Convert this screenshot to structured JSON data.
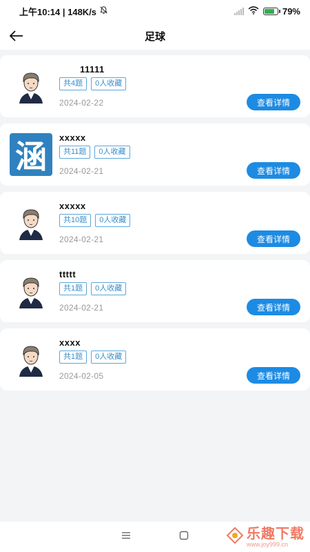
{
  "status_bar": {
    "time_speed": "上午10:14 | 148K/s",
    "battery_percent": "79%",
    "battery_level": 0.79,
    "icons": [
      "mute-bell-icon",
      "signal-icon",
      "wifi-icon",
      "battery-icon"
    ]
  },
  "header": {
    "title": "足球",
    "back_icon": "back-arrow-icon"
  },
  "cards": [
    {
      "title": "11111",
      "tag_count": "共4题",
      "tag_fav": "0人收藏",
      "date": "2024-02-22",
      "button": "查看详情",
      "avatar": "cartoon-boy-avatar"
    },
    {
      "title": "xxxxx",
      "tag_count": "共11题",
      "tag_fav": "0人收藏",
      "date": "2024-02-21",
      "button": "查看详情",
      "avatar": "涵"
    },
    {
      "title": "xxxxx",
      "tag_count": "共10题",
      "tag_fav": "0人收藏",
      "date": "2024-02-21",
      "button": "查看详情",
      "avatar": "cartoon-boy-avatar"
    },
    {
      "title": "ttttt",
      "tag_count": "共1题",
      "tag_fav": "0人收藏",
      "date": "2024-02-21",
      "button": "查看详情",
      "avatar": "cartoon-boy-avatar"
    },
    {
      "title": "xxxx",
      "tag_count": "共1题",
      "tag_fav": "0人收藏",
      "date": "2024-02-05",
      "button": "查看详情",
      "avatar": "cartoon-boy-avatar"
    }
  ],
  "nav_bar": {
    "icons": [
      "menu-icon",
      "home-icon"
    ]
  },
  "watermark": {
    "text": "乐趣下载",
    "url": "www.joy999.cn"
  },
  "colors": {
    "accent": "#1d8be3",
    "tag_border": "#5aa7da",
    "background": "#f3f4f6",
    "battery_green": "#2bb24c"
  }
}
